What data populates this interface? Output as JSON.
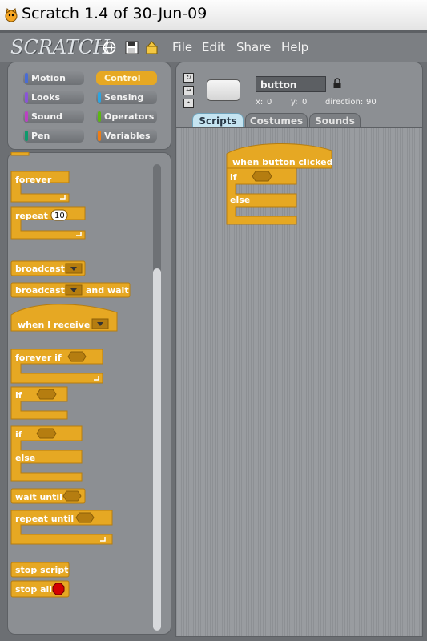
{
  "window": {
    "title": "Scratch 1.4 of 30-Jun-09"
  },
  "app": {
    "logo": "SCRATCH",
    "menu": [
      "File",
      "Edit",
      "Share",
      "Help"
    ],
    "toolbar_icons": [
      "globe-icon",
      "save-icon",
      "share-icon"
    ]
  },
  "categories": [
    {
      "label": "Motion",
      "color": "#4a6cd4"
    },
    {
      "label": "Control",
      "color": "#e6a823",
      "selected": true
    },
    {
      "label": "Looks",
      "color": "#8a55d7"
    },
    {
      "label": "Sensing",
      "color": "#2ca5e2"
    },
    {
      "label": "Sound",
      "color": "#bb42c3"
    },
    {
      "label": "Operators",
      "color": "#5cb712"
    },
    {
      "label": "Pen",
      "color": "#0e9a6c"
    },
    {
      "label": "Variables",
      "color": "#ee7d16"
    }
  ],
  "palette": {
    "forever": "forever",
    "repeat": "repeat",
    "repeat_value": "10",
    "broadcast": "broadcast",
    "broadcast_wait": "broadcast",
    "and_wait": "and wait",
    "when_receive": "when I receive",
    "forever_if": "forever if",
    "if1": "if",
    "if2": "if",
    "else": "else",
    "wait_until": "wait until",
    "repeat_until": "repeat until",
    "stop_script": "stop script",
    "stop_all": "stop all"
  },
  "sprite": {
    "name": "button",
    "x_label": "x:",
    "x_value": "0",
    "y_label": "y:",
    "y_value": "0",
    "direction_label": "direction:",
    "direction_value": "90"
  },
  "tabs": [
    "Scripts",
    "Costumes",
    "Sounds"
  ],
  "script": {
    "hat": "when button clicked",
    "if": "if",
    "else": "else"
  },
  "colors": {
    "control": "#e6a823",
    "control_dark": "#b57d10",
    "stop_red": "#d40000"
  }
}
